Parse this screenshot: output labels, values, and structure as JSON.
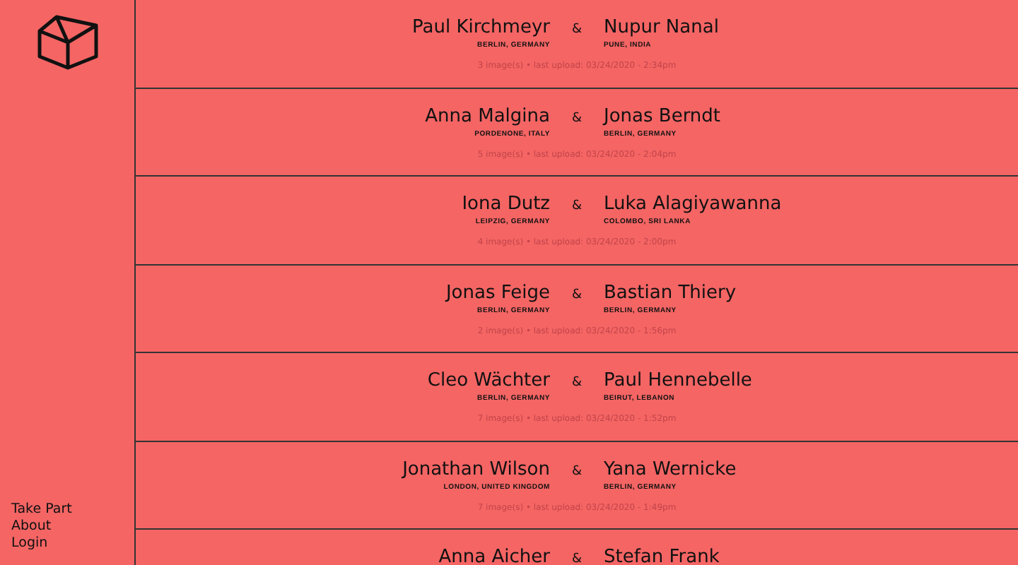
{
  "sidebar": {
    "nav": [
      "Take Part",
      "About",
      "Login"
    ]
  },
  "pairs": [
    {
      "left": {
        "name": "Paul Kirchmeyr",
        "location": "BERLIN, GERMANY"
      },
      "separator": "&",
      "right": {
        "name": "Nupur Nanal",
        "location": "PUNE, INDIA"
      },
      "meta": "3 image(s) • last upload: 03/24/2020 - 2:34pm"
    },
    {
      "left": {
        "name": "Anna Malgina",
        "location": "PORDENONE, ITALY"
      },
      "separator": "&",
      "right": {
        "name": "Jonas Berndt",
        "location": "BERLIN, GERMANY"
      },
      "meta": "5 image(s) • last upload: 03/24/2020 - 2:04pm"
    },
    {
      "left": {
        "name": "Iona Dutz",
        "location": "LEIPZIG, GERMANY"
      },
      "separator": "&",
      "right": {
        "name": "Luka Alagiyawanna",
        "location": "COLOMBO, SRI LANKA"
      },
      "meta": "4 image(s) • last upload: 03/24/2020 - 2:00pm"
    },
    {
      "left": {
        "name": "Jonas Feige",
        "location": "BERLIN, GERMANY"
      },
      "separator": "&",
      "right": {
        "name": "Bastian Thiery",
        "location": "BERLIN, GERMANY"
      },
      "meta": "2 image(s) • last upload: 03/24/2020 - 1:56pm"
    },
    {
      "left": {
        "name": "Cleo Wächter",
        "location": "BERLIN, GERMANY"
      },
      "separator": "&",
      "right": {
        "name": "Paul Hennebelle",
        "location": "BEIRUT, LEBANON"
      },
      "meta": "7 image(s) • last upload: 03/24/2020 - 1:52pm"
    },
    {
      "left": {
        "name": "Jonathan Wilson",
        "location": "LONDON, UNITED KINGDOM"
      },
      "separator": "&",
      "right": {
        "name": "Yana Wernicke",
        "location": "BERLIN, GERMANY"
      },
      "meta": "7 image(s) • last upload: 03/24/2020 - 1:49pm"
    },
    {
      "left": {
        "name": "Anna Aicher"
      },
      "separator": "&",
      "right": {
        "name": "Stefan Frank"
      }
    }
  ]
}
